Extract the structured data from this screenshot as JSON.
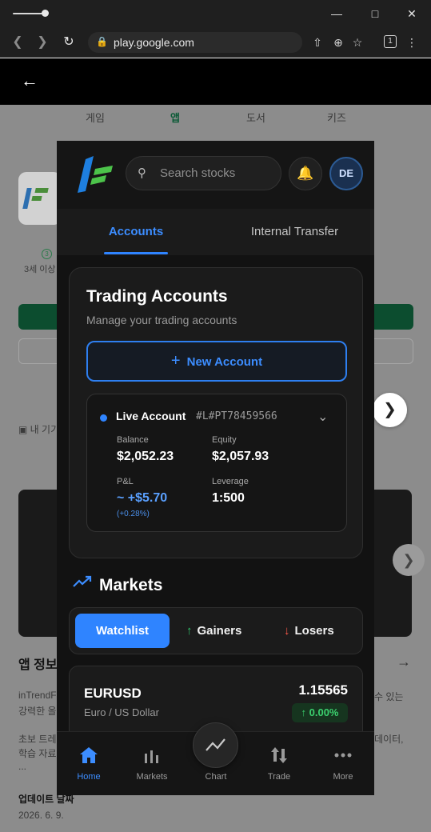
{
  "browser": {
    "url": "play.google.com",
    "tab_count": "1"
  },
  "store": {
    "tabs": [
      "게임",
      "앱",
      "도서",
      "키즈"
    ],
    "age_rating_icon": "3",
    "age_rating": "3세 이상",
    "device_label": "내 기기",
    "app_info_title": "앱 정보",
    "desc_line1_left": "inTrendF",
    "desc_line1_right": "수 있는",
    "desc_line2_left": "강력한 올",
    "desc_line3_left": "초보 트레",
    "desc_line3_right": "데이터,",
    "desc_line4_left": "학습 자료",
    "desc_more": "...",
    "update_title": "업데이트 날짜",
    "update_date": "2026. 6. 9."
  },
  "app": {
    "search_placeholder": "Search stocks",
    "avatar_initials": "DE",
    "tabs": {
      "accounts": "Accounts",
      "transfer": "Internal Transfer"
    },
    "card": {
      "title": "Trading Accounts",
      "subtitle": "Manage your trading accounts",
      "new_account": "New Account"
    },
    "account": {
      "name": "Live Account",
      "id": "#L#PT78459566",
      "balance_label": "Balance",
      "balance": "$2,052.23",
      "equity_label": "Equity",
      "equity": "$2,057.93",
      "pl_label": "P&L",
      "pl": "~ +$5.70",
      "pl_pct": "(+0.28%)",
      "leverage_label": "Leverage",
      "leverage": "1:500"
    },
    "markets": {
      "title": "Markets",
      "segments": {
        "watchlist": "Watchlist",
        "gainers": "Gainers",
        "losers": "Losers"
      }
    },
    "quote": {
      "symbol": "EURUSD",
      "name": "Euro / US Dollar",
      "price": "1.15565",
      "change": "0.00%"
    },
    "nav": {
      "home": "Home",
      "markets": "Markets",
      "chart": "Chart",
      "trade": "Trade",
      "more": "More"
    }
  },
  "colors": {
    "accent": "#2f84ff",
    "positive": "#3bd06e",
    "negative": "#ff5a4a",
    "background": "#121212"
  }
}
